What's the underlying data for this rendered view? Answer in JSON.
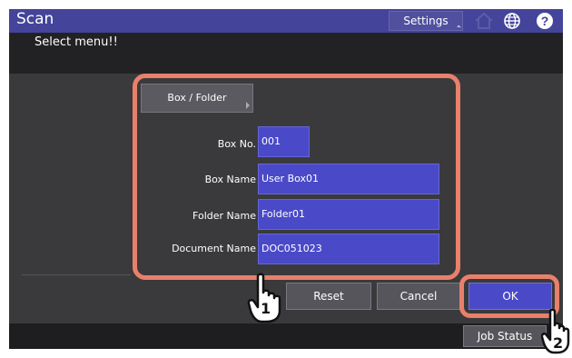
{
  "header": {
    "title": "Scan",
    "settings_label": "Settings"
  },
  "icons": {
    "home": "home-icon",
    "globe": "globe-icon",
    "help": "help-icon"
  },
  "message": "Select menu!!",
  "box_folder_label": "Box / Folder",
  "fields": {
    "box_no": {
      "label": "Box No.",
      "value": "001"
    },
    "box_name": {
      "label": "Box Name",
      "value": "User Box01"
    },
    "folder_name": {
      "label": "Folder Name",
      "value": "Folder01"
    },
    "document_name": {
      "label": "Document Name",
      "value": "DOC051023"
    }
  },
  "buttons": {
    "reset": "Reset",
    "cancel": "Cancel",
    "ok": "OK",
    "job_status": "Job Status"
  },
  "callouts": {
    "one": "1",
    "two": "2"
  },
  "colors": {
    "accent_frame": "#e8806b",
    "field_blue": "#4a4ac8",
    "title_blue": "#44449a"
  }
}
